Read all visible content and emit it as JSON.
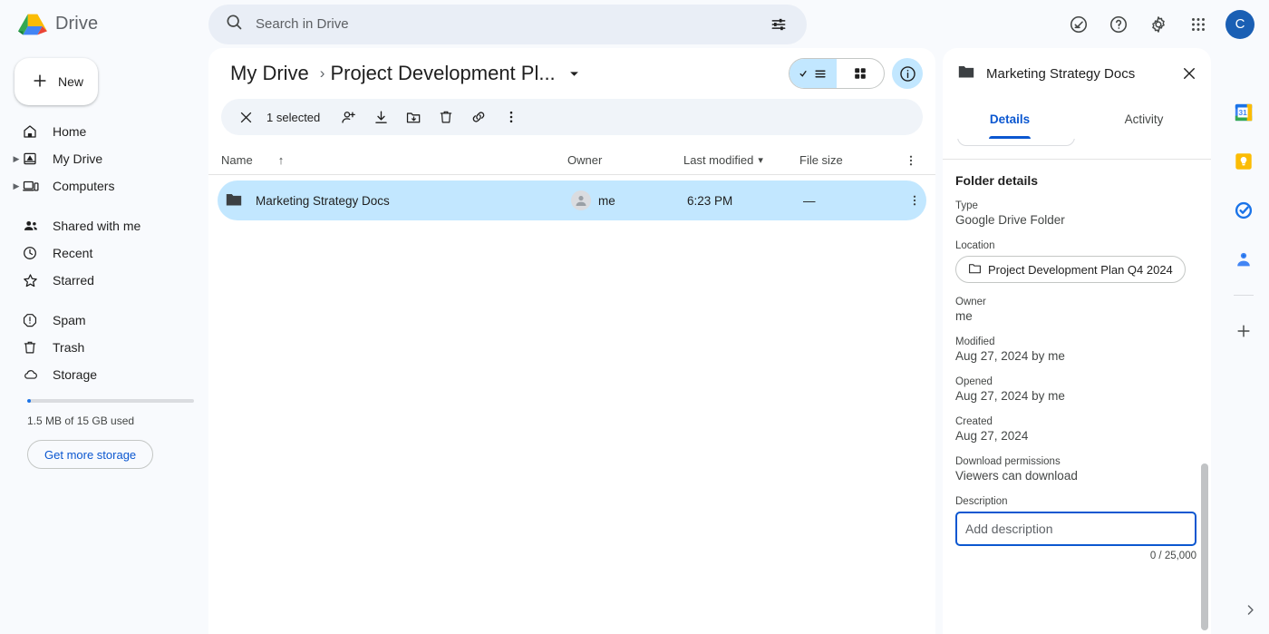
{
  "brand": {
    "name": "Drive",
    "logo_icon": "drive-logo-icon"
  },
  "search": {
    "placeholder": "Search in Drive",
    "value": "",
    "search_icon": "search-icon",
    "options_icon": "tune-options-icon"
  },
  "topbar_actions": {
    "support_label": "Support",
    "help_label": "Help",
    "settings_label": "Settings",
    "apps_label": "Google apps",
    "avatar_initial": "C"
  },
  "sidebar": {
    "new_button": {
      "label": "New",
      "icon": "plus-icon"
    },
    "items": [
      {
        "label": "Home",
        "icon": "home-icon",
        "expandable": false
      },
      {
        "label": "My Drive",
        "icon": "my-drive-icon",
        "expandable": true
      },
      {
        "label": "Computers",
        "icon": "computers-icon",
        "expandable": true
      },
      {
        "label": "Shared with me",
        "icon": "shared-people-icon",
        "expandable": false
      },
      {
        "label": "Recent",
        "icon": "clock-icon",
        "expandable": false
      },
      {
        "label": "Starred",
        "icon": "star-icon",
        "expandable": false
      },
      {
        "label": "Spam",
        "icon": "spam-alert-icon",
        "expandable": false
      },
      {
        "label": "Trash",
        "icon": "trash-icon",
        "expandable": false
      },
      {
        "label": "Storage",
        "icon": "cloud-icon",
        "expandable": false
      }
    ],
    "storage": {
      "usage_text": "1.5 MB of 15 GB used",
      "button_label": "Get more storage",
      "percent_used": 0.01
    }
  },
  "breadcrumb": {
    "root": "My Drive",
    "separator": "›",
    "current": "Project Development Pl...",
    "caret_icon": "chevron-down-icon"
  },
  "view_controls": {
    "list_view_label": "List view",
    "grid_view_label": "Grid view",
    "info_label": "View details",
    "active_view": "list"
  },
  "selection_toolbar": {
    "close_label": "Clear selection",
    "count_text": "1 selected",
    "actions": [
      {
        "name": "share-button",
        "label": "Share"
      },
      {
        "name": "download-button",
        "label": "Download"
      },
      {
        "name": "move-to-folder-button",
        "label": "Move to"
      },
      {
        "name": "remove-button",
        "label": "Move to trash"
      },
      {
        "name": "get-link-button",
        "label": "Get link"
      },
      {
        "name": "more-actions-button",
        "label": "More actions"
      }
    ]
  },
  "file_table": {
    "columns": {
      "name": "Name",
      "sort_arrow": "↑",
      "owner": "Owner",
      "last_modified": "Last modified",
      "last_modified_caret": "▾",
      "file_size": "File size"
    },
    "rows": [
      {
        "name": "Marketing Strategy Docs",
        "icon": "folder-icon",
        "owner": "me",
        "last_modified": "6:23 PM",
        "file_size": "—",
        "selected": true
      }
    ]
  },
  "details_panel": {
    "title": "Marketing Strategy Docs",
    "title_icon": "folder-icon",
    "close_icon": "close-icon",
    "tabs": [
      {
        "label": "Details",
        "active": true
      },
      {
        "label": "Activity",
        "active": false
      }
    ],
    "section_title": "Folder details",
    "fields": [
      {
        "label": "Type",
        "value": "Google Drive Folder"
      },
      {
        "label": "Owner",
        "value": "me"
      },
      {
        "label": "Modified",
        "value": "Aug 27, 2024 by me"
      },
      {
        "label": "Opened",
        "value": "Aug 27, 2024 by me"
      },
      {
        "label": "Created",
        "value": "Aug 27, 2024"
      },
      {
        "label": "Download permissions",
        "value": "Viewers can download"
      }
    ],
    "location": {
      "label": "Location",
      "chip_text": "Project Development Plan Q4 2024",
      "chip_icon": "folder-outline-icon"
    },
    "description": {
      "label": "Description",
      "placeholder": "Add description",
      "value": "",
      "counter": "0 / 25,000"
    }
  },
  "right_rail": {
    "items": [
      {
        "name": "google-calendar-icon",
        "label": "Calendar"
      },
      {
        "name": "google-keep-icon",
        "label": "Keep"
      },
      {
        "name": "google-tasks-icon",
        "label": "Tasks"
      },
      {
        "name": "google-contacts-icon",
        "label": "Contacts"
      }
    ],
    "add_label": "Get add-ons",
    "expand_label": "Show side panel"
  },
  "colors": {
    "accent_blue": "#0b57d0",
    "selected_row": "#c2e7ff",
    "page_bg": "#f8fafd",
    "panel_bg": "#ffffff",
    "avatar_bg": "#1a5fb4"
  }
}
